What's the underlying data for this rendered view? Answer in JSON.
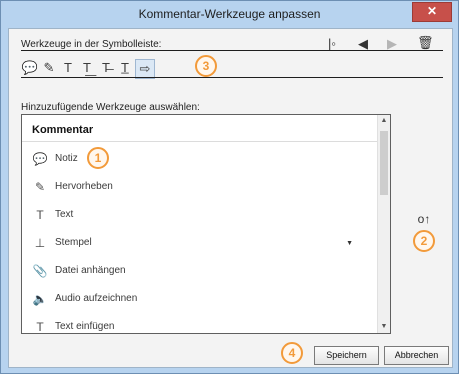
{
  "window": {
    "title": "Kommentar-Werkzeuge anpassen",
    "close_glyph": "✕"
  },
  "toolbar_section": {
    "label": "Werkzeuge in der Symbolleiste:",
    "nav_icons": [
      "move-to-start-icon",
      "move-left-icon",
      "move-right-icon",
      "trash-icon"
    ],
    "tools": [
      {
        "name": "comment-icon",
        "glyph": "💬"
      },
      {
        "name": "highlighter-icon",
        "glyph": "✎"
      },
      {
        "name": "text-icon",
        "glyph": "T"
      },
      {
        "name": "insert-text-icon",
        "glyph": "T͟"
      },
      {
        "name": "strikethrough-text-icon",
        "glyph": "T̶"
      },
      {
        "name": "underline-text-icon",
        "glyph": "T̲"
      },
      {
        "name": "arrow-icon",
        "glyph": "⇨"
      }
    ]
  },
  "list_section": {
    "label": "Hinzuzufügende Werkzeuge auswählen:",
    "header": "Kommentar",
    "items": [
      {
        "label": "Notiz",
        "icon": "speech-bubble-icon",
        "glyph": "💬"
      },
      {
        "label": "Hervorheben",
        "icon": "highlighter-icon",
        "glyph": "✎"
      },
      {
        "label": "Text",
        "icon": "text-icon",
        "glyph": "T"
      },
      {
        "label": "Stempel",
        "icon": "stamp-icon",
        "glyph": "⊥",
        "has_dropdown": true
      },
      {
        "label": "Datei anhängen",
        "icon": "paperclip-icon",
        "glyph": "📎"
      },
      {
        "label": "Audio aufzeichnen",
        "icon": "speaker-icon",
        "glyph": "🔈"
      },
      {
        "label": "Text einfügen",
        "icon": "insert-text-icon",
        "glyph": "T"
      }
    ]
  },
  "side_action": {
    "icon": "add-to-toolbar-icon",
    "glyph": "o↑"
  },
  "callouts": [
    "1",
    "2",
    "3",
    "4"
  ],
  "buttons": {
    "save": "Speichern",
    "cancel": "Abbrechen"
  },
  "colors": {
    "accent": "#f29a3a",
    "frame": "#b7d3ef",
    "close": "#c7504a"
  }
}
